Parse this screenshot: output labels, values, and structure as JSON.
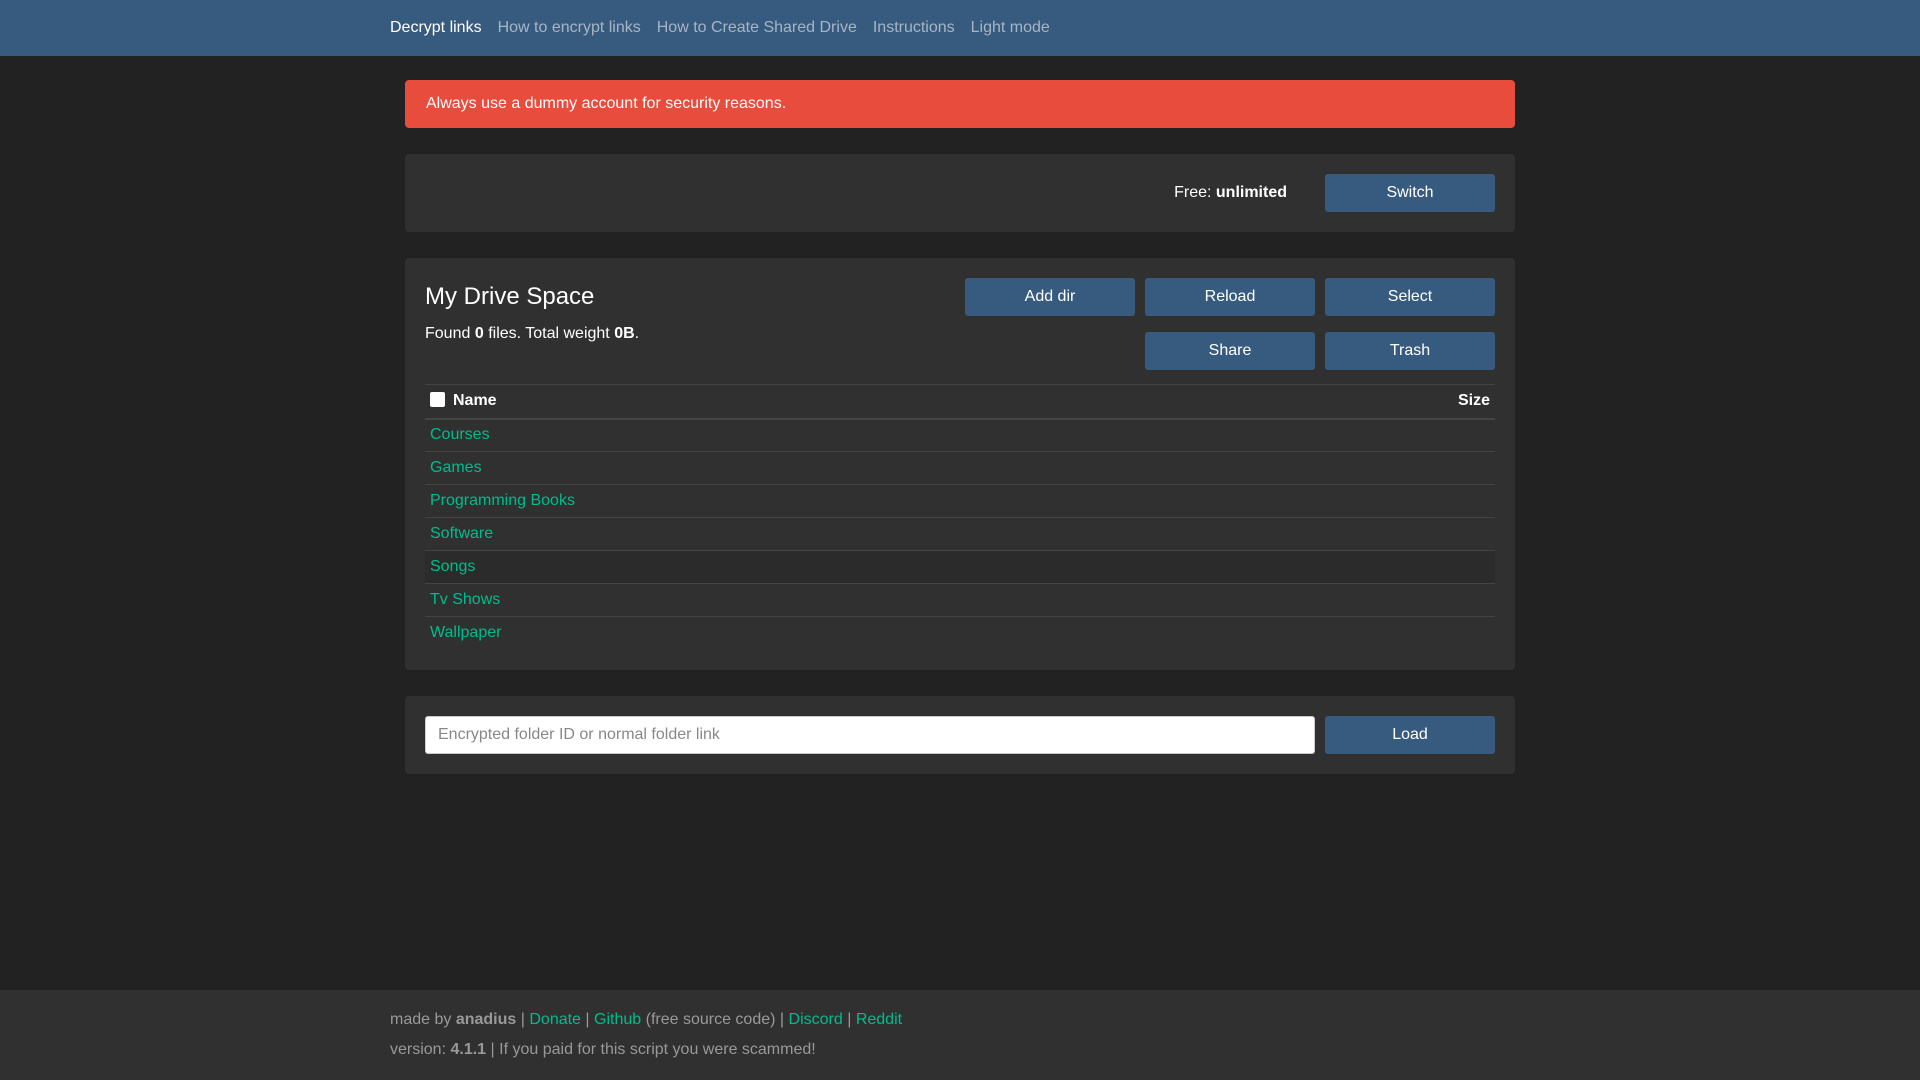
{
  "navbar": {
    "links": [
      {
        "label": "Decrypt links",
        "active": true
      },
      {
        "label": "How to encrypt links",
        "active": false
      },
      {
        "label": "How to Create Shared Drive",
        "active": false
      },
      {
        "label": "Instructions",
        "active": false
      },
      {
        "label": "Light mode",
        "active": false
      }
    ]
  },
  "alert": {
    "message": "Always use a dummy account for security reasons."
  },
  "quota": {
    "label": "Free:",
    "value": "unlimited",
    "switch_label": "Switch"
  },
  "drive": {
    "title": "My Drive Space",
    "found_prefix": "Found",
    "file_count": "0",
    "files_mid": "files. Total weight",
    "total_weight": "0B",
    "suffix": ".",
    "buttons": {
      "add_dir": "Add dir",
      "reload": "Reload",
      "select": "Select",
      "share": "Share",
      "trash": "Trash"
    },
    "table": {
      "col_name": "Name",
      "col_size": "Size",
      "rows": [
        {
          "name": "Courses",
          "size": ""
        },
        {
          "name": "Games",
          "size": ""
        },
        {
          "name": "Programming Books",
          "size": ""
        },
        {
          "name": "Software",
          "size": ""
        },
        {
          "name": "Songs",
          "size": ""
        },
        {
          "name": "Tv Shows",
          "size": ""
        },
        {
          "name": "Wallpaper",
          "size": ""
        }
      ]
    }
  },
  "loader": {
    "placeholder": "Encrypted folder ID or normal folder link",
    "value": "",
    "button_label": "Load"
  },
  "footer": {
    "made_by": "made by",
    "author": "anadius",
    "sep": "|",
    "donate": "Donate",
    "github": "Github",
    "github_note": "(free source code)",
    "discord": "Discord",
    "reddit": "Reddit",
    "version_label": "version:",
    "version": "4.1.1",
    "scam_note": "| If you paid for this script you were scammed!"
  },
  "colors": {
    "background": "#222222",
    "navbar": "#375a7f",
    "card": "#303030",
    "alert": "#e74c3c",
    "button": "#375a7f",
    "link": "#00bc8c",
    "muted": "#999999"
  }
}
